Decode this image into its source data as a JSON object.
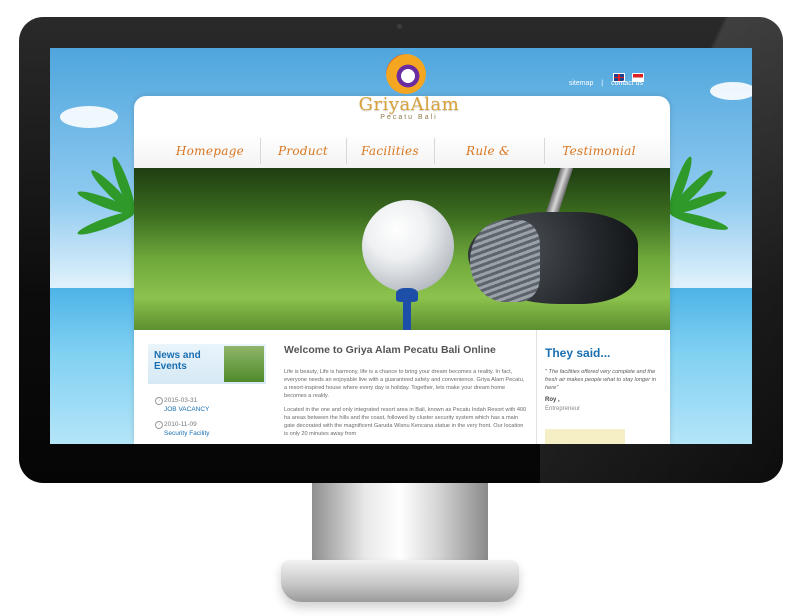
{
  "brand": {
    "name": "GriyaAlam",
    "tagline": "Pecatu Bali"
  },
  "toplinks": {
    "sitemap": "sitemap",
    "separator": "|",
    "contact": "contact us"
  },
  "nav": {
    "items": [
      "Homepage",
      "Product",
      "Facilities",
      "Rule & Conditions",
      "Testimonial"
    ]
  },
  "news": {
    "title_line1": "News and",
    "title_line2": "Events",
    "items": [
      {
        "date": "2015-03-31",
        "title": "JOB VACANCY"
      },
      {
        "date": "2010-11-09",
        "title": "Security Facility"
      }
    ]
  },
  "welcome": {
    "title": "Welcome to Griya Alam Pecatu Bali Online",
    "paragraph1": "Life is beauty, Life is harmony, life is a chance to bring your dream becomes a reality. In fact, everyone needs an enjoyable live with a guaranteed safety and convenience. Griya Alam Pecatu, a resort-inspired house where every day is holiday. Together, lets make your dream home becomes a reality.",
    "paragraph2": "Located in the one and only integrated resort area in Bali, known as Pecatu Indah Resort with 400 ha areas between the hills and the coast, followed by cluster security system which has a main gate decorated with the magnificent Garuda Wisnu Kencana statue in the very front. Our location is only 20 minutes away from"
  },
  "testimonial": {
    "title": "They said...",
    "quote": "\" The facilities offered very complete and the fresh air makes people what to stay longer in here\"",
    "name": "Roy ,",
    "role": "Entrepreneur"
  },
  "colors": {
    "accent_blue": "#1a6fb0",
    "nav_orange": "#d9761f",
    "logo_gold": "#d9a23b"
  }
}
